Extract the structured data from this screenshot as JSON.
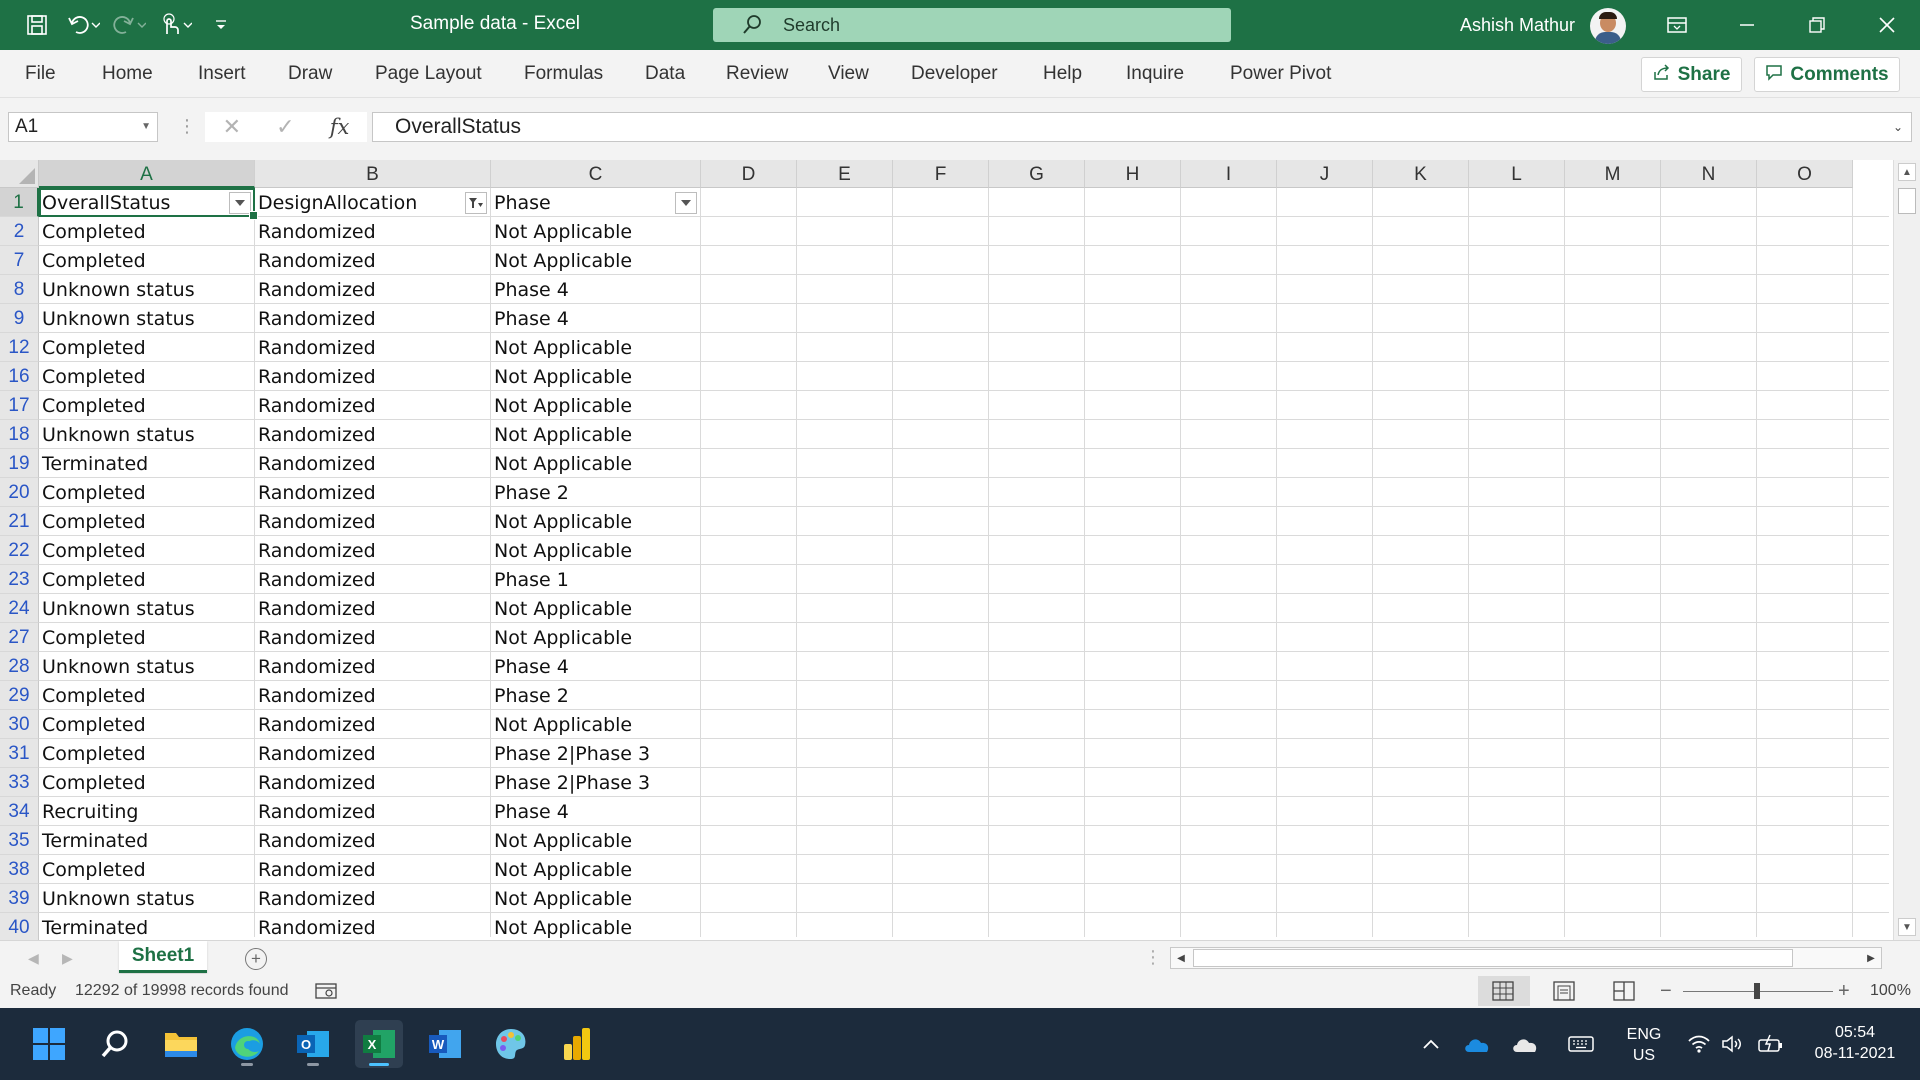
{
  "window": {
    "title": "Sample data  -  Excel",
    "search_placeholder": "Search",
    "user_name": "Ashish Mathur"
  },
  "ribbon": {
    "tabs": [
      "File",
      "Home",
      "Insert",
      "Draw",
      "Page Layout",
      "Formulas",
      "Data",
      "Review",
      "View",
      "Developer",
      "Help",
      "Inquire",
      "Power Pivot"
    ],
    "share_label": "Share",
    "comments_label": "Comments"
  },
  "formula_bar": {
    "name_box": "A1",
    "formula": "OverallStatus"
  },
  "sheet": {
    "columns": [
      "A",
      "B",
      "C",
      "D",
      "E",
      "F",
      "G",
      "H",
      "I",
      "J",
      "K",
      "L",
      "M",
      "N",
      "O"
    ],
    "header_row_number": "1",
    "headers": [
      "OverallStatus",
      "DesignAllocation",
      "Phase"
    ],
    "rows": [
      {
        "n": "2",
        "cells": [
          "Completed",
          "Randomized",
          "Not Applicable"
        ]
      },
      {
        "n": "7",
        "cells": [
          "Completed",
          "Randomized",
          "Not Applicable"
        ]
      },
      {
        "n": "8",
        "cells": [
          "Unknown status",
          "Randomized",
          "Phase 4"
        ]
      },
      {
        "n": "9",
        "cells": [
          "Unknown status",
          "Randomized",
          "Phase 4"
        ]
      },
      {
        "n": "12",
        "cells": [
          "Completed",
          "Randomized",
          "Not Applicable"
        ]
      },
      {
        "n": "16",
        "cells": [
          "Completed",
          "Randomized",
          "Not Applicable"
        ]
      },
      {
        "n": "17",
        "cells": [
          "Completed",
          "Randomized",
          "Not Applicable"
        ]
      },
      {
        "n": "18",
        "cells": [
          "Unknown status",
          "Randomized",
          "Not Applicable"
        ]
      },
      {
        "n": "19",
        "cells": [
          "Terminated",
          "Randomized",
          "Not Applicable"
        ]
      },
      {
        "n": "20",
        "cells": [
          "Completed",
          "Randomized",
          "Phase 2"
        ]
      },
      {
        "n": "21",
        "cells": [
          "Completed",
          "Randomized",
          "Not Applicable"
        ]
      },
      {
        "n": "22",
        "cells": [
          "Completed",
          "Randomized",
          "Not Applicable"
        ]
      },
      {
        "n": "23",
        "cells": [
          "Completed",
          "Randomized",
          "Phase 1"
        ]
      },
      {
        "n": "24",
        "cells": [
          "Unknown status",
          "Randomized",
          "Not Applicable"
        ]
      },
      {
        "n": "27",
        "cells": [
          "Completed",
          "Randomized",
          "Not Applicable"
        ]
      },
      {
        "n": "28",
        "cells": [
          "Unknown status",
          "Randomized",
          "Phase 4"
        ]
      },
      {
        "n": "29",
        "cells": [
          "Completed",
          "Randomized",
          "Phase 2"
        ]
      },
      {
        "n": "30",
        "cells": [
          "Completed",
          "Randomized",
          "Not Applicable"
        ]
      },
      {
        "n": "31",
        "cells": [
          "Completed",
          "Randomized",
          "Phase 2|Phase 3"
        ]
      },
      {
        "n": "33",
        "cells": [
          "Completed",
          "Randomized",
          "Phase 2|Phase 3"
        ]
      },
      {
        "n": "34",
        "cells": [
          "Recruiting",
          "Randomized",
          "Phase 4"
        ]
      },
      {
        "n": "35",
        "cells": [
          "Terminated",
          "Randomized",
          "Not Applicable"
        ]
      },
      {
        "n": "38",
        "cells": [
          "Completed",
          "Randomized",
          "Not Applicable"
        ]
      },
      {
        "n": "39",
        "cells": [
          "Unknown status",
          "Randomized",
          "Not Applicable"
        ]
      },
      {
        "n": "40",
        "cells": [
          "Terminated",
          "Randomized",
          "Not Applicable"
        ]
      }
    ],
    "tab_name": "Sheet1"
  },
  "status_bar": {
    "ready": "Ready",
    "records": "12292 of 19998 records found",
    "zoom": "100%"
  },
  "taskbar": {
    "language": "ENG",
    "region": "US",
    "time": "05:54",
    "date": "08-11-2021"
  },
  "colors": {
    "excel_green": "#1e7145",
    "search_bg": "#9fd5b7",
    "taskbar_bg": "#1c2b3c"
  }
}
